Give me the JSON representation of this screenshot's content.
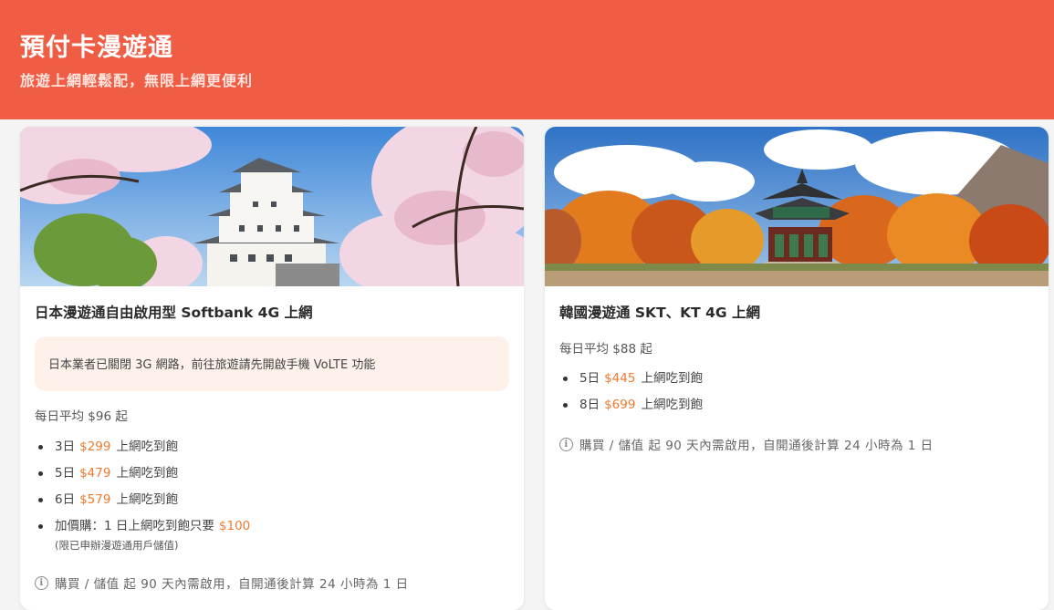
{
  "header": {
    "title": "預付卡漫遊通",
    "subtitle": "旅遊上網輕鬆配，無限上網更便利"
  },
  "colors": {
    "brand": "#ef5d44",
    "price": "#f07a2e",
    "notice_bg": "#fdf1ea"
  },
  "cards": [
    {
      "title": "日本漫遊通自由啟用型 Softbank 4G 上網",
      "notice": "日本業者已關閉 3G 網路，前往旅遊請先開啟手機 VoLTE 功能",
      "daily": "每日平均 $96 起",
      "plans": [
        {
          "days": "3日",
          "price": "$299",
          "desc": "上網吃到飽"
        },
        {
          "days": "5日",
          "price": "$479",
          "desc": "上網吃到飽"
        },
        {
          "days": "6日",
          "price": "$579",
          "desc": "上網吃到飽"
        }
      ],
      "addon": {
        "label": "加價購：1 日上網吃到飽只要",
        "price": "$100",
        "note": "(限已申辦漫遊通用戶儲值)"
      },
      "info": "購買 / 儲值 起 90 天內需啟用，自開通後計算 24 小時為 1 日"
    },
    {
      "title": "韓國漫遊通 SKT、KT 4G 上網",
      "daily": "每日平均 $88 起",
      "plans": [
        {
          "days": "5日",
          "price": "$445",
          "desc": "上網吃到飽"
        },
        {
          "days": "8日",
          "price": "$699",
          "desc": "上網吃到飽"
        }
      ],
      "info": "購買 / 儲值 起 90 天內需啟用，自開通後計算 24 小時為 1 日"
    }
  ],
  "icons": {
    "info": "info-circle-icon"
  }
}
